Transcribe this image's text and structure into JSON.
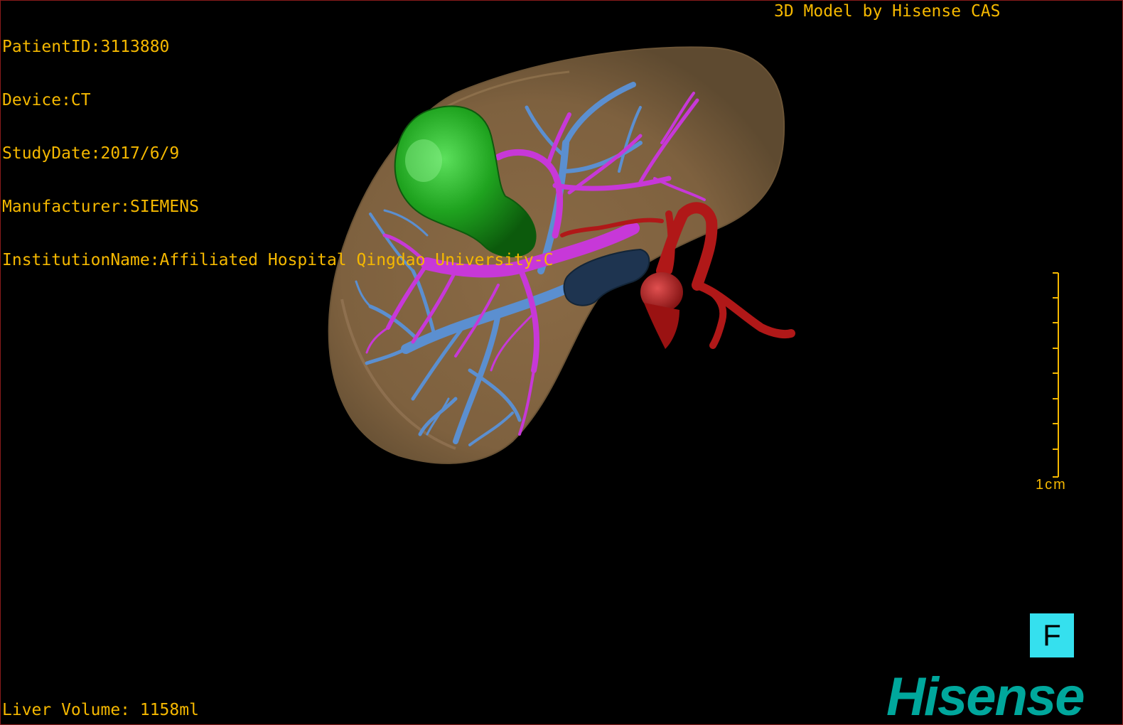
{
  "study_info": {
    "patient_id": "PatientID:3113880",
    "device": "Device:CT",
    "study_date": "StudyDate:2017/6/9",
    "manufacturer": "Manufacturer:SIEMENS",
    "institution": "InstitutionName:Affiliated Hospital Qingdao University-C"
  },
  "model_credit": "3D Model by Hisense CAS",
  "liver_volume": "Liver Volume: 1158ml",
  "scale": {
    "label": "1cm",
    "color": "#f5b800"
  },
  "orientation_button": {
    "label": "F",
    "color": "#35e0ee"
  },
  "brand": {
    "name": "Hisense",
    "color": "#00a79c"
  },
  "colors": {
    "text": "#f5b800",
    "liver": "#8a6a45",
    "tumor": "#1e9a1e",
    "portal_vein": "#c738d8",
    "hepatic_vein": "#5b8fd0",
    "artery": "#b01818",
    "ivc": "#1e3450"
  }
}
